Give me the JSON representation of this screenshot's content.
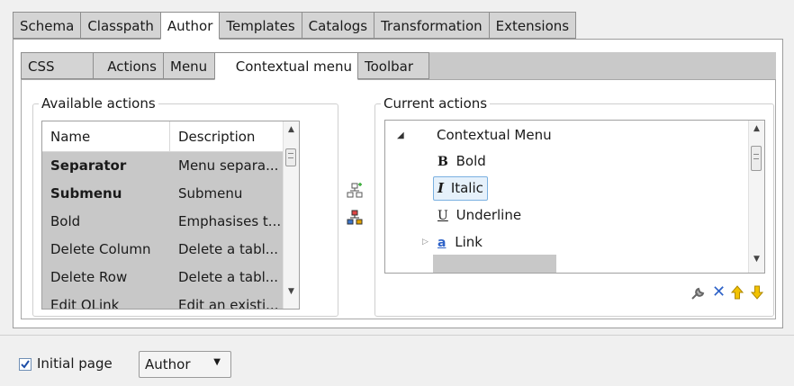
{
  "tabs": [
    "Schema",
    "Classpath",
    "Author",
    "Templates",
    "Catalogs",
    "Transformation",
    "Extensions"
  ],
  "active_tab": "Author",
  "subtabs": [
    "CSS",
    "Actions",
    "Menu",
    "Contextual menu",
    "Toolbar"
  ],
  "active_subtab": "Contextual menu",
  "available": {
    "legend": "Available actions",
    "col_name": "Name",
    "col_desc": "Description",
    "rows": [
      {
        "name": "Separator",
        "desc": "Menu separa..."
      },
      {
        "name": "Submenu",
        "desc": "Submenu"
      },
      {
        "name": "Bold",
        "desc": "Emphasises t..."
      },
      {
        "name": "Delete Column",
        "desc": "Delete a tabl..."
      },
      {
        "name": "Delete Row",
        "desc": "Delete a tabl..."
      },
      {
        "name": "Edit OLink",
        "desc": "Edit an existi..."
      }
    ]
  },
  "current": {
    "legend": "Current actions",
    "root": "Contextual Menu",
    "items": [
      {
        "glyph": "B",
        "label": "Bold"
      },
      {
        "glyph": "I",
        "label": "Italic"
      },
      {
        "glyph": "U",
        "label": "Underline"
      },
      {
        "glyph": "a",
        "label": "Link"
      }
    ]
  },
  "bottom": {
    "initial_page_label": "Initial page",
    "initial_page_checked": true,
    "initial_page_value": "Author"
  },
  "colors": {
    "accent": "#3b73c7",
    "arrow_yellow": "#e0b000",
    "delete_blue": "#2f63c8"
  }
}
